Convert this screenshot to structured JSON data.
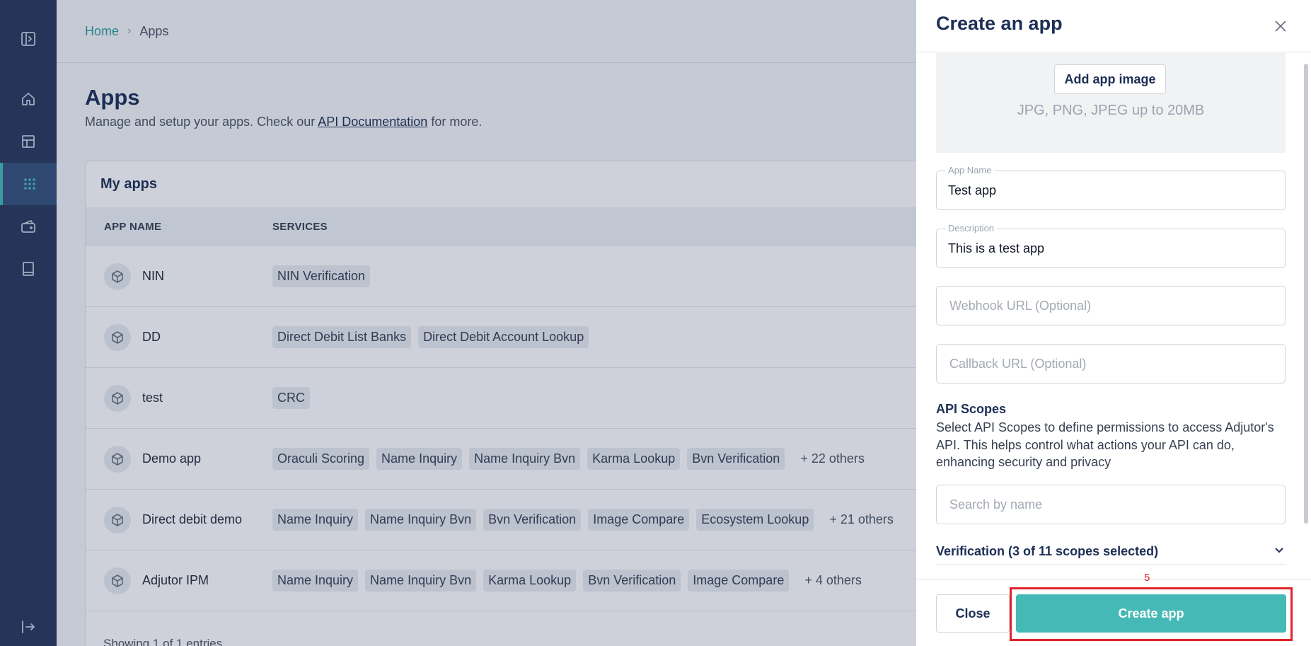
{
  "breadcrumb": {
    "home": "Home",
    "separator": "›",
    "current": "Apps"
  },
  "page": {
    "title": "Apps",
    "subtitle_before": "Manage and setup your apps. Check our ",
    "subtitle_link": "API Documentation",
    "subtitle_after": " for more."
  },
  "sidebar": {
    "icons": [
      "panel-expand-icon",
      "home-icon",
      "dashboard-icon",
      "apps-grid-icon",
      "wallet-icon",
      "book-icon",
      "logout-icon"
    ],
    "active": "apps-grid-icon"
  },
  "apps_card": {
    "title": "My apps",
    "columns": [
      "APP NAME",
      "SERVICES"
    ],
    "rows": [
      {
        "name": "NIN",
        "services": [
          "NIN Verification"
        ],
        "more": ""
      },
      {
        "name": "DD",
        "services": [
          "Direct Debit List Banks",
          "Direct Debit Account Lookup"
        ],
        "more": ""
      },
      {
        "name": "test",
        "services": [
          "CRC"
        ],
        "more": ""
      },
      {
        "name": "Demo app",
        "services": [
          "Oraculi Scoring",
          "Name Inquiry",
          "Name Inquiry Bvn",
          "Karma Lookup",
          "Bvn Verification"
        ],
        "more": "+ 22 others"
      },
      {
        "name": "Direct debit demo",
        "services": [
          "Name Inquiry",
          "Name Inquiry Bvn",
          "Bvn Verification",
          "Image Compare",
          "Ecosystem Lookup"
        ],
        "more": "+ 21 others"
      },
      {
        "name": "Adjutor IPM",
        "services": [
          "Name Inquiry",
          "Name Inquiry Bvn",
          "Karma Lookup",
          "Bvn Verification",
          "Image Compare"
        ],
        "more": "+ 4 others"
      }
    ],
    "showing": "Showing 1 of 1 entries"
  },
  "drawer": {
    "title": "Create an app",
    "upload": {
      "button": "Add app image",
      "hint": "JPG, PNG, JPEG up to 20MB"
    },
    "app_name": {
      "label": "App Name",
      "value": "Test app"
    },
    "description": {
      "label": "Description",
      "value": "This is a test app"
    },
    "webhook": {
      "placeholder": "Webhook URL (Optional)"
    },
    "callback": {
      "placeholder": "Callback URL (Optional)"
    },
    "scopes": {
      "title": "API Scopes",
      "description": "Select API Scopes to define permissions to access Adjutor's API. This helps control what actions your API can do, enhancing security and privacy",
      "search_placeholder": "Search by name",
      "group_label": "Verification (3 of 11 scopes selected)"
    },
    "step_marker": "5",
    "close_button": "Close",
    "create_button": "Create app"
  },
  "colors": {
    "sidebar": "#27365a",
    "accent": "#45b9b5",
    "highlight": "#e0242b"
  }
}
